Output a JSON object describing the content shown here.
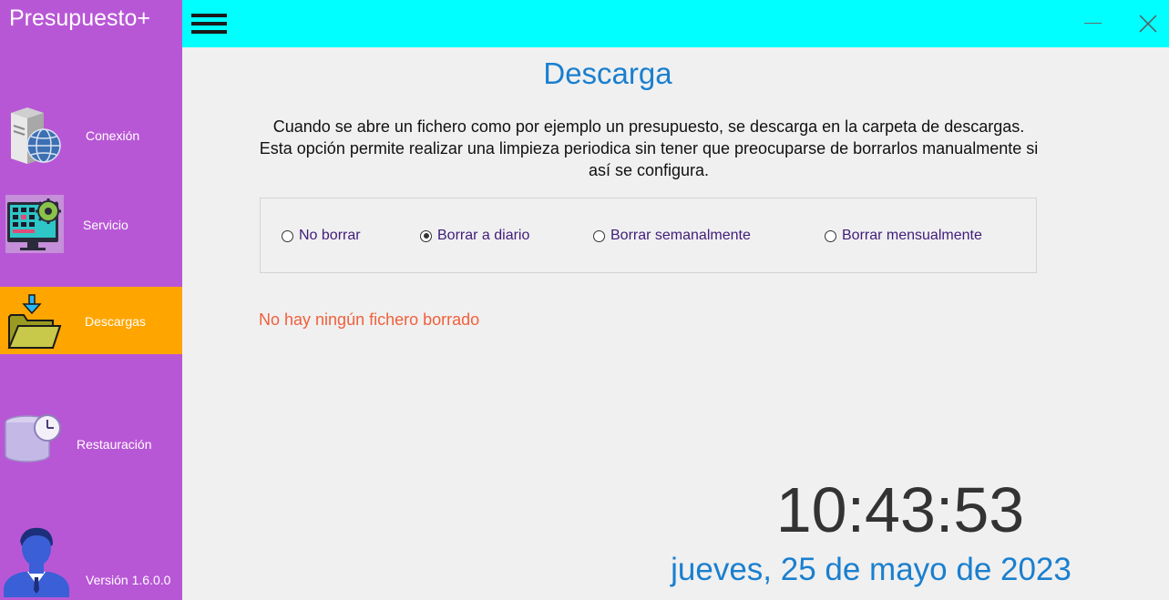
{
  "app": {
    "title": "Presupuesto+",
    "version": "Versión 1.6.0.0"
  },
  "sidebar": {
    "items": [
      {
        "label": "Conexión",
        "icon": "server-globe-icon"
      },
      {
        "label": "Servicio",
        "icon": "monitor-gear-icon"
      },
      {
        "label": "Descargas",
        "icon": "folder-download-icon",
        "active": true
      },
      {
        "label": "Restauración",
        "icon": "database-clock-icon"
      }
    ],
    "user_icon": "user-avatar-icon"
  },
  "topbar": {
    "menu_icon": "hamburger-icon",
    "minimize_icon": "minimize-icon",
    "close_icon": "close-icon"
  },
  "main": {
    "title": "Descarga",
    "description": "Cuando se abre un fichero como por ejemplo un presupuesto,  se descarga en la carpeta de descargas. Esta opción permite realizar una limpieza periodica sin tener que preocuparse de borrarlos manualmente si así se configura.",
    "options": [
      {
        "label": "No borrar",
        "checked": false
      },
      {
        "label": "Borrar a diario",
        "checked": true
      },
      {
        "label": "Borrar semanalmente",
        "checked": false
      },
      {
        "label": "Borrar mensualmente",
        "checked": false
      }
    ],
    "status": "No hay ningún fichero borrado",
    "clock": {
      "time": "10:43:53",
      "date": "jueves, 25 de mayo de 2023"
    }
  },
  "colors": {
    "sidebar_bg": "#b857d6",
    "active_item_bg": "#ffa500",
    "topbar_bg": "#00ffff",
    "title_blue": "#1a7fcf",
    "status_red": "#f0603c",
    "option_text": "#3f1d7a"
  }
}
